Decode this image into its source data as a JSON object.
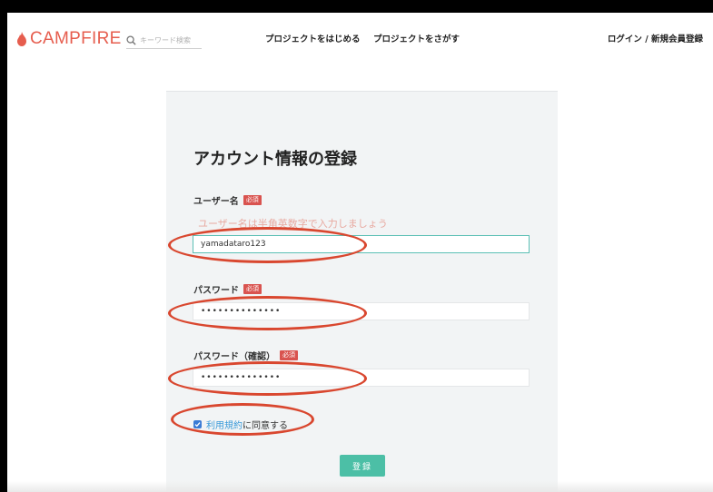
{
  "header": {
    "logo_text": "CAMPFIRE",
    "search_placeholder": "キーワード検索",
    "nav_start": "プロジェクトをはじめる",
    "nav_find": "プロジェクトをさがす",
    "login": "ログイン / 新規会員登録"
  },
  "form": {
    "title": "アカウント情報の登録",
    "required_badge": "必須",
    "username": {
      "label": "ユーザー名",
      "hint": "ユーザー名は半角英数字で入力しましょう",
      "value": "yamadataro123"
    },
    "password": {
      "label": "パスワード",
      "value": "••••••••••••••"
    },
    "password_confirm": {
      "label": "パスワード（確認）",
      "value": "••••••••••••••"
    },
    "agree": {
      "checked": true,
      "terms_link": "利用規約",
      "text": "に同意する"
    },
    "submit_label": "登録"
  },
  "colors": {
    "brand": "#e65d4e",
    "annotation": "#d9472f",
    "submit": "#4cbfa6",
    "link": "#3a9ad9",
    "focus": "#5cc0b5"
  }
}
